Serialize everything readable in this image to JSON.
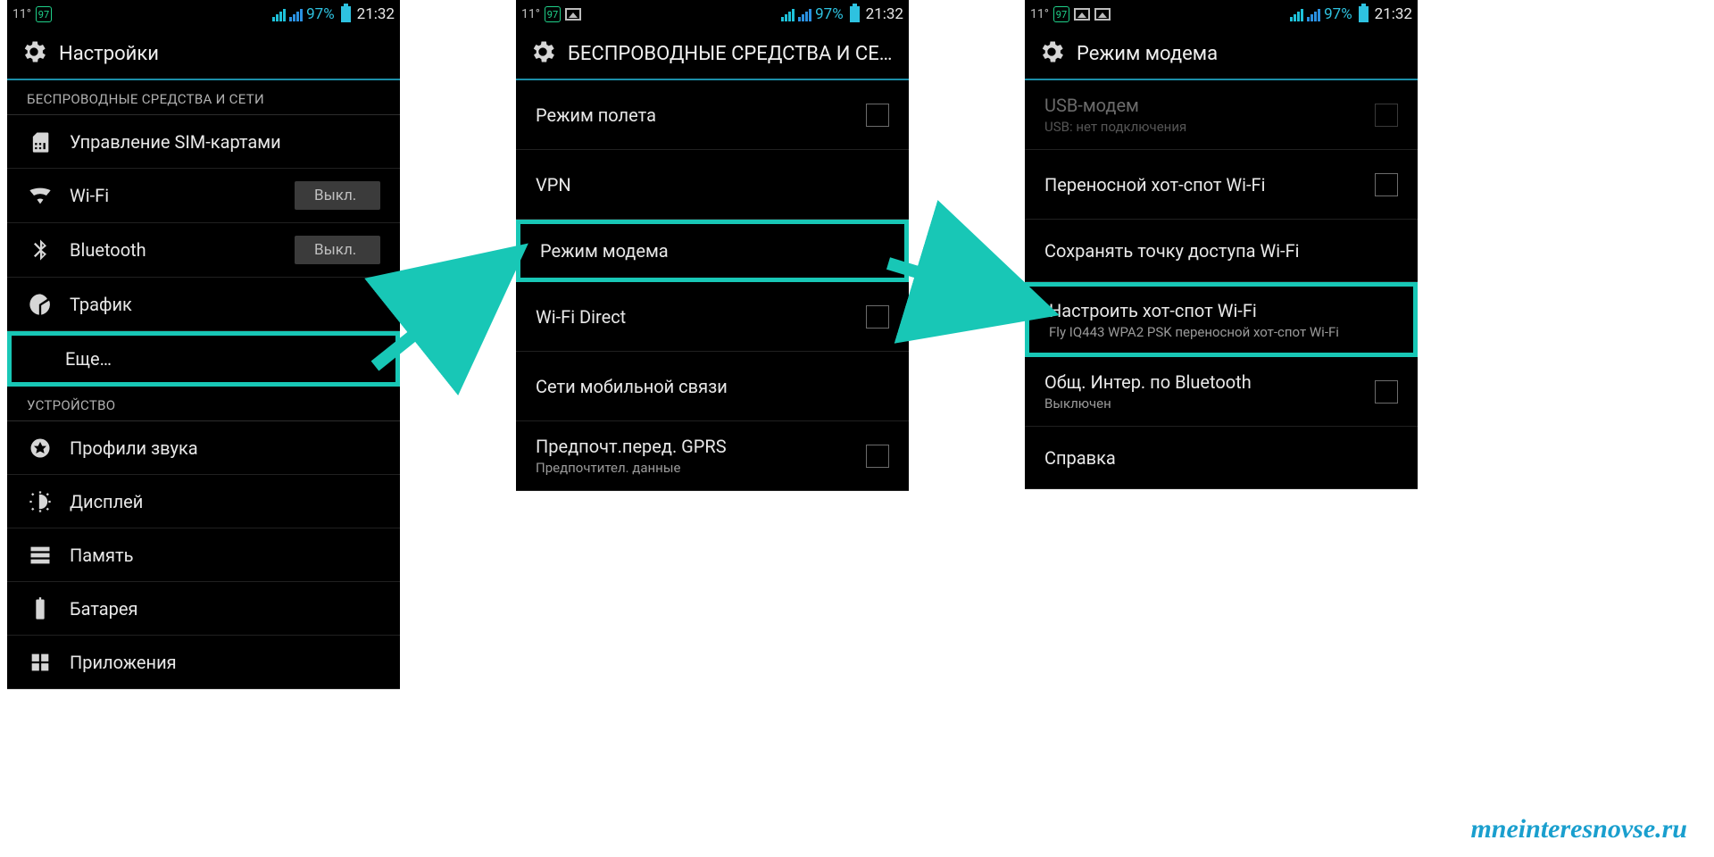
{
  "status": {
    "temp": "11°",
    "badge": "97",
    "battery_pct": "97%",
    "clock": "21:32"
  },
  "screen1": {
    "title": "Настройки",
    "section_wireless": "БЕСПРОВОДНЫЕ СРЕДСТВА И СЕТИ",
    "sim": "Управление SIM-картами",
    "wifi": "Wi-Fi",
    "wifi_state": "Выкл.",
    "bt": "Bluetooth",
    "bt_state": "Выкл.",
    "traffic": "Трафик",
    "more": "Еще…",
    "section_device": "УСТРОЙСТВО",
    "sound": "Профили звука",
    "display": "Дисплей",
    "memory": "Память",
    "battery": "Батарея",
    "apps": "Приложения"
  },
  "screen2": {
    "title": "БЕСПРОВОДНЫЕ СРЕДСТВА И СЕ…",
    "airplane": "Режим полета",
    "vpn": "VPN",
    "tether": "Режим модема",
    "wifi_direct": "Wi-Fi Direct",
    "mobile_net": "Сети мобильной связи",
    "gprs": "Предпочт.перед. GPRS",
    "gprs_sub": "Предпочтител. данные"
  },
  "screen3": {
    "title": "Режим модема",
    "usb": "USB-модем",
    "usb_sub": "USB: нет подключения",
    "hotspot": "Переносной хот-спот Wi-Fi",
    "keep": "Сохранять точку доступа Wi-Fi",
    "setup": "Настроить хот-спот Wi-Fi",
    "setup_sub": "Fly IQ443 WPA2 PSK переносной хот-спот Wi-Fi",
    "bt_share": "Общ. Интер. по Bluetooth",
    "bt_share_sub": "Выключен",
    "help": "Справка"
  },
  "watermark": "mneinteresnovse.ru"
}
